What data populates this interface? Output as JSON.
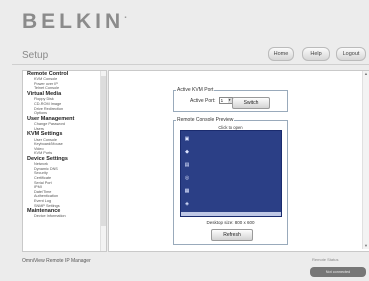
{
  "header": {
    "brand": "BELKIN",
    "brand_mark": ".",
    "page_title": "Setup",
    "buttons": {
      "home": "Home",
      "help": "Help",
      "logout": "Logout"
    }
  },
  "sidebar": {
    "groups": [
      {
        "title": "Remote Control",
        "items": [
          "KVM Console",
          "Power over IP",
          "Telnet Console"
        ]
      },
      {
        "title": "Virtual Media",
        "items": [
          "Floppy Disk",
          "CD-ROM Image",
          "Drive Redirection",
          "Options"
        ]
      },
      {
        "title": "User Management",
        "items": [
          "Change Password",
          "Users"
        ]
      },
      {
        "title": "KVM Settings",
        "items": [
          "User Console",
          "Keyboard/Mouse",
          "Video",
          "KVM Ports"
        ]
      },
      {
        "title": "Device Settings",
        "items": [
          "Network",
          "Dynamic DNS",
          "Security",
          "Certificate",
          "Serial Port",
          "IPMI",
          "Date/Time",
          "Authentication",
          "Event Log",
          "SNMP Settings"
        ]
      },
      {
        "title": "Maintenance",
        "items": [
          "Device Information"
        ]
      }
    ]
  },
  "main": {
    "kvm_port": {
      "legend": "Active KVM Port",
      "label": "Active Port:",
      "selected": "1",
      "switch_label": "Switch"
    },
    "preview": {
      "legend": "Remote Console Preview",
      "click_again": "Click to open",
      "desktop_size": "Desktop size: 800 x 600",
      "refresh_label": "Refresh"
    }
  },
  "footer": {
    "product": "OmniView Remote IP Manager",
    "status": "Remote Status",
    "connection": "Not connected"
  },
  "colors": {
    "desktop": "#2b3f86",
    "logo": "#8b8b8b"
  }
}
